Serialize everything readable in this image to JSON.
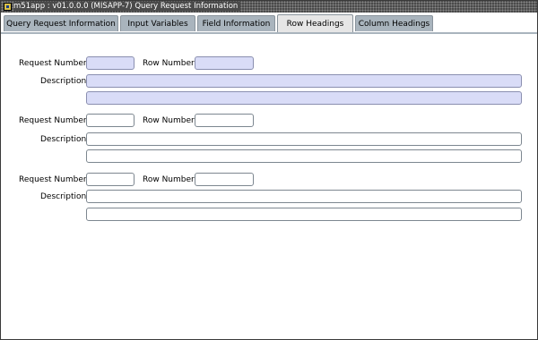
{
  "window": {
    "title": "m51app : v01.0.0.0 (MISAPP-7) Query Request Information"
  },
  "tabs": [
    {
      "label": "Query Request Information",
      "active": false
    },
    {
      "label": "Input Variables",
      "active": false
    },
    {
      "label": "Field Information",
      "active": false
    },
    {
      "label": "Row Headings",
      "active": true
    },
    {
      "label": "Column Headings",
      "active": false
    }
  ],
  "labels": {
    "request_number": "Request Number",
    "row_number": "Row Number",
    "description": "Description"
  },
  "records": [
    {
      "request_number": "",
      "row_number": "",
      "description_line1": "",
      "description_line2": "",
      "highlighted": true
    },
    {
      "request_number": "",
      "row_number": "",
      "description_line1": "",
      "description_line2": "",
      "highlighted": false
    },
    {
      "request_number": "",
      "row_number": "",
      "description_line1": "",
      "description_line2": "",
      "highlighted": false
    }
  ],
  "colors": {
    "titlebar": "#4a4a4a",
    "tab_inactive": "#a9b4bd",
    "tab_active": "#e6e6e6",
    "field_highlight": "#d9dcf7"
  }
}
